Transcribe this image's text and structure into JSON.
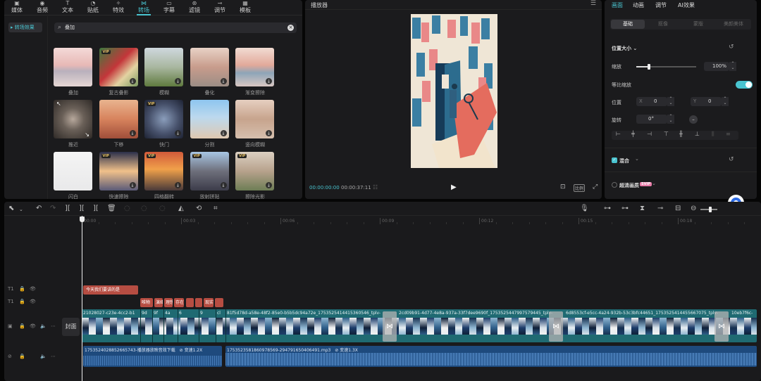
{
  "toolbar": {
    "tabs": [
      {
        "label": "媒体",
        "icon": "media-icon"
      },
      {
        "label": "音频",
        "icon": "audio-icon"
      },
      {
        "label": "文本",
        "icon": "text-icon"
      },
      {
        "label": "贴纸",
        "icon": "sticker-icon"
      },
      {
        "label": "特效",
        "icon": "effects-icon"
      },
      {
        "label": "转场",
        "icon": "transition-icon",
        "active": true
      },
      {
        "label": "字幕",
        "icon": "subtitle-icon"
      },
      {
        "label": "滤镜",
        "icon": "filter-icon"
      },
      {
        "label": "调节",
        "icon": "adjust-icon"
      },
      {
        "label": "模板",
        "icon": "template-icon"
      }
    ]
  },
  "left_panel": {
    "category": "转场效果",
    "search_value": "叠加",
    "items": [
      {
        "label": "叠加",
        "vip": false,
        "download": false
      },
      {
        "label": "复古叠影",
        "vip": true,
        "download": true
      },
      {
        "label": "模糊",
        "vip": false,
        "download": true
      },
      {
        "label": "叠化",
        "vip": false,
        "download": true
      },
      {
        "label": "渐变擦除",
        "vip": false,
        "download": true
      },
      {
        "label": "推近",
        "vip": false,
        "download": false
      },
      {
        "label": "下移",
        "vip": false,
        "download": true
      },
      {
        "label": "快门",
        "vip": true,
        "download": true
      },
      {
        "label": "分割",
        "vip": false,
        "download": true
      },
      {
        "label": "竖向模糊",
        "vip": false,
        "download": true
      },
      {
        "label": "闪白",
        "vip": false,
        "download": false
      },
      {
        "label": "快速擦除",
        "vip": true,
        "download": true
      },
      {
        "label": "四格翻转",
        "vip": true,
        "download": true
      },
      {
        "label": "放射拼贴",
        "vip": true,
        "download": true
      },
      {
        "label": "擦除光影",
        "vip": true,
        "download": true
      }
    ]
  },
  "player": {
    "title": "播放器",
    "current_time": "00:00:00:00",
    "total_time": "00:00:37:11",
    "ratio": "比例"
  },
  "right_panel": {
    "tabs": [
      "画面",
      "动画",
      "调节",
      "AI效果"
    ],
    "subtabs": [
      "基础",
      "抠像",
      "蒙版",
      "美颜美体"
    ],
    "section_position": "位置大小",
    "scale_label": "缩放",
    "scale_value": "100%",
    "uniform_label": "等比缩放",
    "position_label": "位置",
    "pos_x_label": "X",
    "pos_x": "0",
    "pos_y_label": "Y",
    "pos_y": "0",
    "rotate_label": "旋转",
    "rotate_value": "0°",
    "blend_label": "混合",
    "hd_label": "超清画质",
    "hd_badge": "SVIP"
  },
  "timeline": {
    "ticks": [
      "00:00",
      "00:03",
      "00:06",
      "00:09",
      "00:12",
      "00:15",
      "00:18"
    ],
    "text_clip": "今天我们要讲的是",
    "sub_clips": [
      "唯物",
      "演绎",
      "理想",
      "存在",
      "",
      "",
      "现实",
      ""
    ],
    "cover_label": "封面",
    "video_clips": [
      "21028027-c23e-4cc2-b1",
      "9d",
      "9f",
      "4a",
      "6",
      "9",
      "cl",
      "81f5d78d-a58e-48f2-85e0-b5b5dc94a72e_1753525414415360546_tplv-",
      "2cd09b91-4d77-4e8a-937a-33f7dee9690f_1753525447997579445_tplv-",
      "6d8553cf-e5cc-4a24-932b-53c3bfc44651_1753525414455667075_tplv-",
      "10eb7f6c-"
    ],
    "audio_clips": [
      {
        "name": "1753524028852665743-播放器放映音效下载",
        "speed": "变速1.2X"
      },
      {
        "name": "1753523581860978569-294791650406491.mp3",
        "speed": "变速1.3X"
      }
    ]
  }
}
